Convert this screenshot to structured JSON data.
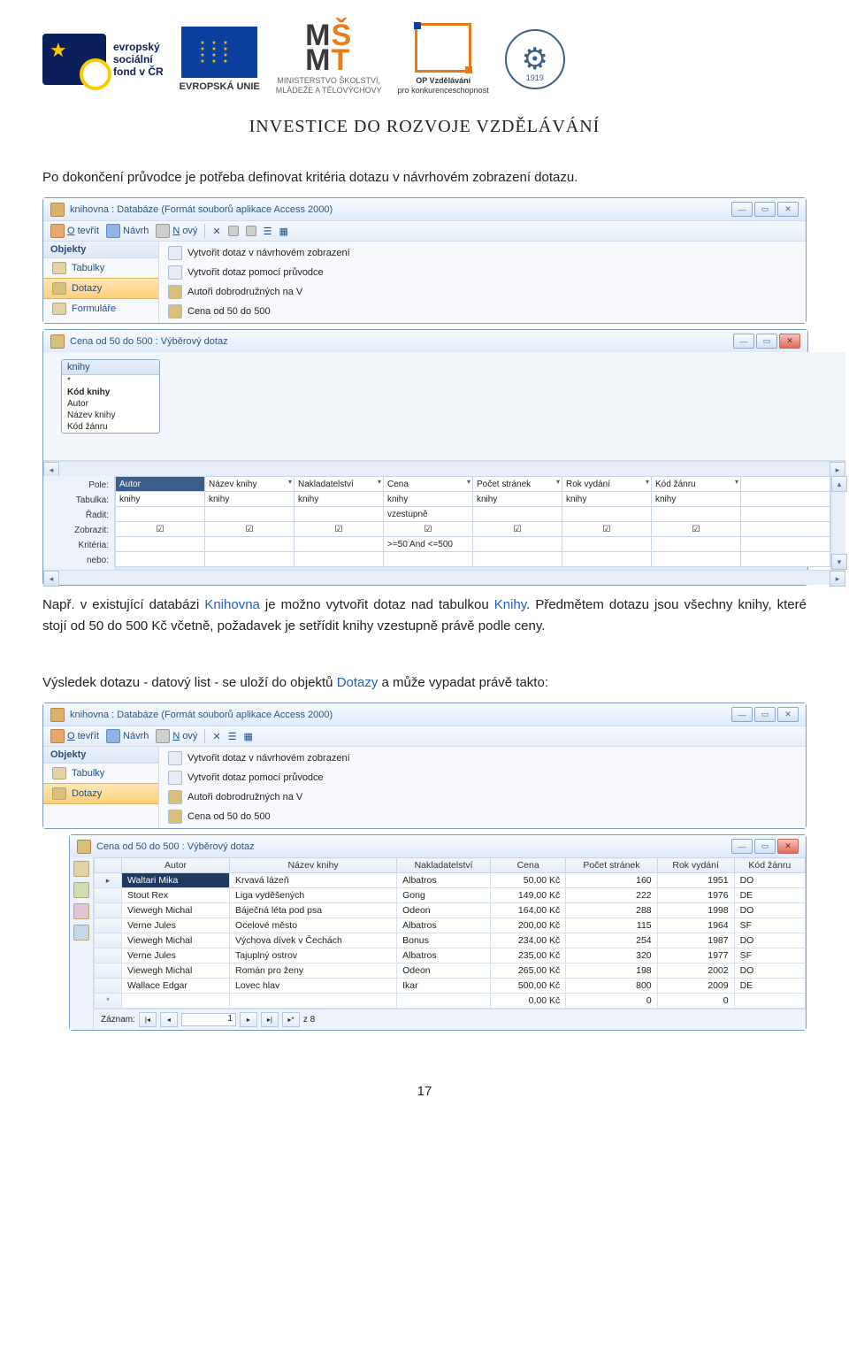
{
  "header": {
    "esf_line1": "evropský",
    "esf_line2": "sociální",
    "esf_line3": "fond v ČR",
    "eu_label": "EVROPSKÁ UNIE",
    "msmt_line1": "MINISTERSTVO ŠKOLSTVÍ,",
    "msmt_line2": "MLÁDEŽE A TĚLOVÝCHOVY",
    "opvk_line1": "OP Vzdělávání",
    "opvk_line2": "pro konkurenceschopnost",
    "gear_year": "1919",
    "invest": "INVESTICE DO ROZVOJE VZDĚLÁVÁNÍ"
  },
  "text": {
    "p1": "Po dokončení průvodce je potřeba definovat kritéria dotazu v návrhovém zobrazení dotazu.",
    "p2a": "Např. v existující databázi ",
    "p2b": "Knihovna",
    "p2c": " je možno vytvořit dotaz nad tabulkou ",
    "p2d": "Knihy",
    "p2e": ". Předmětem dotazu jsou všechny knihy, které stojí od 50 do 500 Kč včetně, požadavek je setřídit knihy vzestupně právě podle ceny.",
    "p3a": "Výsledek dotazu - datový list - se uloží do objektů ",
    "p3b": "Dotazy",
    "p3c": " a může vypadat právě takto:"
  },
  "dbwin": {
    "title": "knihovna : Databáze (Formát souborů aplikace Access 2000)",
    "toolbar": {
      "open": "Otevřít",
      "design": "Návrh",
      "new": "Nový"
    },
    "sidebar": {
      "head": "Objekty",
      "items": [
        "Tabulky",
        "Dotazy",
        "Formuláře"
      ]
    },
    "objects": [
      "Vytvořit dotaz v návrhovém zobrazení",
      "Vytvořit dotaz pomocí průvodce",
      "Autoři dobrodružných na V",
      "Cena od 50 do 500"
    ]
  },
  "qwin": {
    "title": "Cena od 50 do 500 : Výběrový dotaz",
    "tablebox": {
      "name": "knihy",
      "fields": [
        "*",
        "Kód knihy",
        "Autor",
        "Název knihy",
        "Kód žánru"
      ]
    },
    "labels": [
      "Pole:",
      "Tabulka:",
      "Řadit:",
      "Zobrazit:",
      "Kritéria:",
      "nebo:"
    ],
    "cols": [
      {
        "field": "Autor",
        "table": "knihy",
        "sort": "",
        "show": true,
        "crit": ""
      },
      {
        "field": "Název knihy",
        "table": "knihy",
        "sort": "",
        "show": true,
        "crit": ""
      },
      {
        "field": "Nakladatelství",
        "table": "knihy",
        "sort": "",
        "show": true,
        "crit": ""
      },
      {
        "field": "Cena",
        "table": "knihy",
        "sort": "vzestupně",
        "show": true,
        "crit": ">=50 And <=500"
      },
      {
        "field": "Počet stránek",
        "table": "knihy",
        "sort": "",
        "show": true,
        "crit": ""
      },
      {
        "field": "Rok vydání",
        "table": "knihy",
        "sort": "",
        "show": true,
        "crit": ""
      },
      {
        "field": "Kód žánru",
        "table": "knihy",
        "sort": "",
        "show": true,
        "crit": ""
      }
    ]
  },
  "resultwin": {
    "title": "Cena od 50 do 500 : Výběrový dotaz",
    "headers": [
      "Autor",
      "Název knihy",
      "Nakladatelství",
      "Cena",
      "Počet stránek",
      "Rok vydání",
      "Kód žánru"
    ],
    "rows": [
      [
        "Waltari Mika",
        "Krvavá lázeň",
        "Albatros",
        "50,00 Kč",
        "160",
        "1951",
        "DO"
      ],
      [
        "Stout Rex",
        "Liga vyděšených",
        "Gong",
        "149,00 Kč",
        "222",
        "1976",
        "DE"
      ],
      [
        "Viewegh Michal",
        "Báječná léta pod psa",
        "Odeon",
        "164,00 Kč",
        "288",
        "1998",
        "DO"
      ],
      [
        "Verne Jules",
        "Ocelové město",
        "Albatros",
        "200,00 Kč",
        "115",
        "1964",
        "SF"
      ],
      [
        "Viewegh Michal",
        "Výchova dívek v Čechách",
        "Bonus",
        "234,00 Kč",
        "254",
        "1987",
        "DO"
      ],
      [
        "Verne Jules",
        "Tajuplný ostrov",
        "Albatros",
        "235,00 Kč",
        "320",
        "1977",
        "SF"
      ],
      [
        "Viewegh Michal",
        "Román pro ženy",
        "Odeon",
        "265,00 Kč",
        "198",
        "2002",
        "DO"
      ],
      [
        "Wallace Edgar",
        "Lovec hlav",
        "Ikar",
        "500,00 Kč",
        "800",
        "2009",
        "DE"
      ]
    ],
    "emptyrow": [
      "",
      "",
      "",
      "0,00 Kč",
      "0",
      "0",
      ""
    ],
    "nav": {
      "label": "Záznam:",
      "pos": "1",
      "of": "z 8"
    }
  },
  "pagenum": "17"
}
